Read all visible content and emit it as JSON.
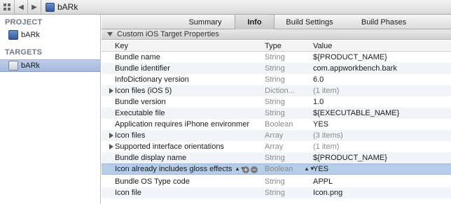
{
  "jumpbar": {
    "crumb": "bARk"
  },
  "sidebar": {
    "project_title": "PROJECT",
    "project_item": "bARk",
    "targets_title": "TARGETS",
    "target_item": "bARk"
  },
  "tabs": [
    "Summary",
    "Info",
    "Build Settings",
    "Build Phases"
  ],
  "active_tab": "Info",
  "section": {
    "title": "Custom iOS Target Properties"
  },
  "table": {
    "headers": {
      "key": "Key",
      "type": "Type",
      "value": "Value"
    },
    "rows": [
      {
        "key": "Bundle name",
        "type": "String",
        "value": "${PRODUCT_NAME}"
      },
      {
        "key": "Bundle identifier",
        "type": "String",
        "value": "com.appworkbench.bark"
      },
      {
        "key": "InfoDictionary version",
        "type": "String",
        "value": "6.0"
      },
      {
        "key": "Icon files (iOS 5)",
        "type": "Diction...",
        "value": "(1 item)"
      },
      {
        "key": "Bundle version",
        "type": "String",
        "value": "1.0"
      },
      {
        "key": "Executable file",
        "type": "String",
        "value": "${EXECUTABLE_NAME}"
      },
      {
        "key": "Application requires iPhone environmer",
        "type": "Boolean",
        "value": "YES"
      },
      {
        "key": "Icon files",
        "type": "Array",
        "value": "(3 items)"
      },
      {
        "key": "Supported interface orientations",
        "type": "Array",
        "value": "(1 item)"
      },
      {
        "key": "Bundle display name",
        "type": "String",
        "value": "${PRODUCT_NAME}"
      },
      {
        "key": "Icon already includes gloss effects",
        "type": "Boolean",
        "value": "YES"
      },
      {
        "key": "Bundle OS Type code",
        "type": "String",
        "value": "APPL"
      },
      {
        "key": "Icon file",
        "type": "String",
        "value": "Icon.png"
      }
    ]
  },
  "controls": {
    "add": "+",
    "remove": "−",
    "stepper": "▲▼"
  },
  "icons": {
    "grid": "grid-icon",
    "back": "back-arrow-icon",
    "forward": "forward-arrow-icon",
    "project": "project-icon",
    "target": "target-icon"
  },
  "colors": {
    "selection": "#b6cdea",
    "sidebar_selection": "#a4b9dc",
    "project_blue": "#34589a"
  }
}
